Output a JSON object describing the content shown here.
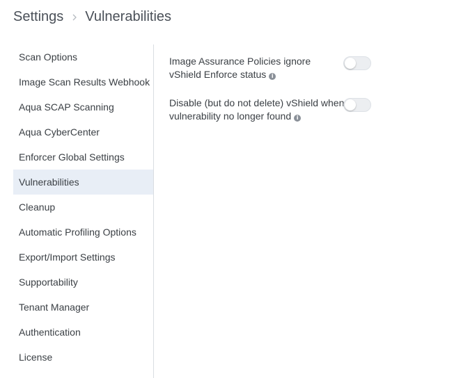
{
  "breadcrumb": {
    "root": "Settings",
    "current": "Vulnerabilities"
  },
  "sidebar": {
    "items": [
      {
        "label": "Scan Options",
        "active": false
      },
      {
        "label": "Image Scan Results Webhook",
        "active": false
      },
      {
        "label": "Aqua SCAP Scanning",
        "active": false
      },
      {
        "label": "Aqua CyberCenter",
        "active": false
      },
      {
        "label": "Enforcer Global Settings",
        "active": false
      },
      {
        "label": "Vulnerabilities",
        "active": true
      },
      {
        "label": "Cleanup",
        "active": false
      },
      {
        "label": "Automatic Profiling Options",
        "active": false
      },
      {
        "label": "Export/Import Settings",
        "active": false
      },
      {
        "label": "Supportability",
        "active": false
      },
      {
        "label": "Tenant Manager",
        "active": false
      },
      {
        "label": "Authentication",
        "active": false
      },
      {
        "label": "License",
        "active": false
      }
    ]
  },
  "settings": [
    {
      "line1": "Image Assurance Policies ignore",
      "line2": "vShield Enforce status",
      "info_icon": "info-icon",
      "enabled": false
    },
    {
      "line1": "Disable (but do not delete) vShield when",
      "line2": "vulnerability no longer found",
      "info_icon": "info-icon",
      "enabled": false
    }
  ],
  "colors": {
    "active_item_bg": "#e8eef6",
    "toggle_off_bg": "#eceef1",
    "divider": "#d9dde2"
  }
}
